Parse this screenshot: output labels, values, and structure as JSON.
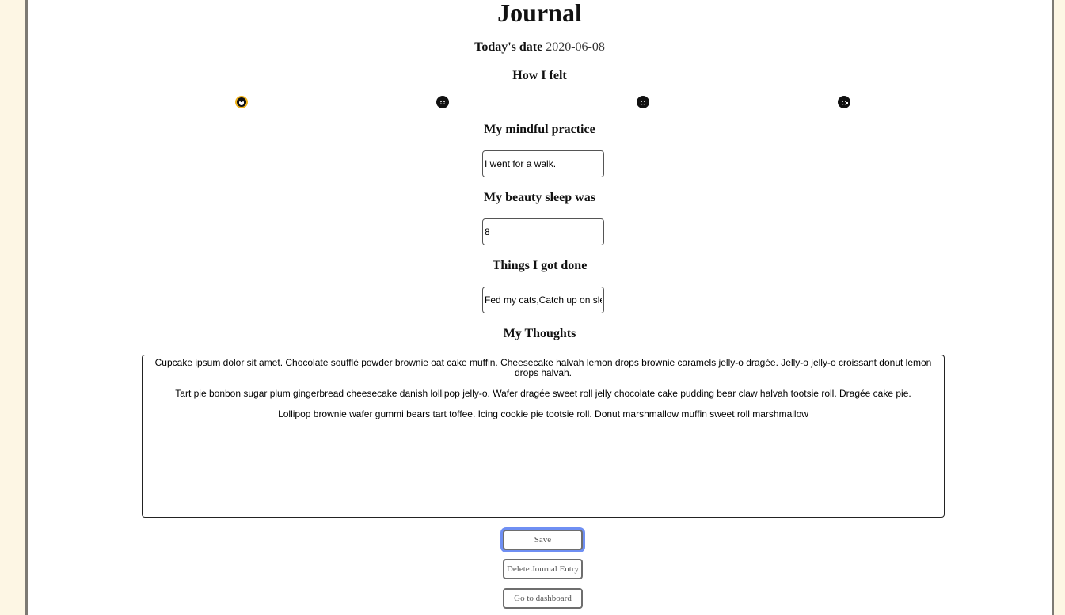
{
  "page": {
    "title": "Journal"
  },
  "date": {
    "label": "Today's date",
    "value": "2020-06-08"
  },
  "mood": {
    "heading": "How I felt",
    "options": [
      {
        "name": "very-happy-face-icon",
        "selected": true
      },
      {
        "name": "happy-face-icon",
        "selected": false
      },
      {
        "name": "frown-face-icon",
        "selected": false
      },
      {
        "name": "sad-face-icon",
        "selected": false
      }
    ],
    "selected_color": "#f0b21a"
  },
  "mindful": {
    "heading": "My mindful practice",
    "value": "I went for a walk."
  },
  "sleep": {
    "heading": "My beauty sleep was",
    "value": "8"
  },
  "done": {
    "heading": "Things I got done",
    "value": "Fed my cats,Catch up on sleep"
  },
  "thoughts": {
    "heading": "My Thoughts",
    "paragraphs": [
      "Cupcake ipsum dolor sit amet. Chocolate soufflé powder brownie oat cake muffin. Cheesecake halvah lemon drops brownie caramels jelly-o dragée. Jelly-o jelly-o croissant donut lemon drops halvah.",
      "Tart pie bonbon sugar plum gingerbread cheesecake danish lollipop jelly-o. Wafer dragée sweet roll jelly chocolate cake pudding bear claw halvah tootsie roll. Dragée cake pie.",
      "Lollipop brownie wafer gummi bears tart toffee. Icing cookie pie tootsie roll. Donut marshmallow muffin sweet roll marshmallow"
    ]
  },
  "buttons": {
    "save": "Save",
    "delete": "Delete Journal Entry",
    "dashboard": "Go to dashboard"
  },
  "colors": {
    "page_background": "#fdf6e4",
    "panel_border": "#7d7a74",
    "focus_ring": "#6f8ff3"
  }
}
